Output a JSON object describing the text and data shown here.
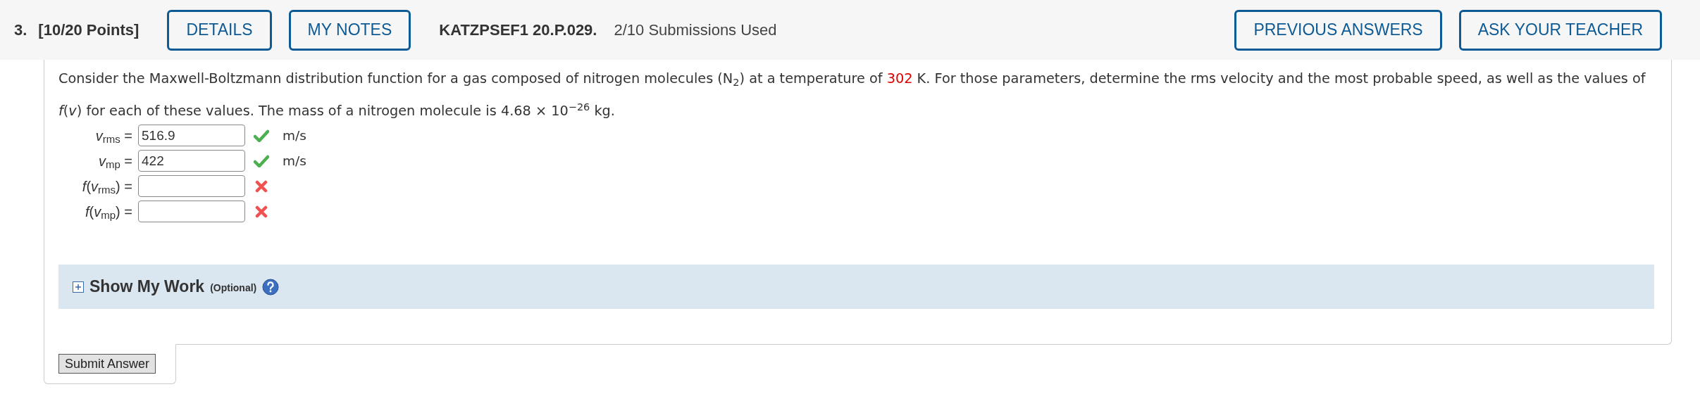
{
  "header": {
    "number": "3.",
    "points": "[10/20 Points]",
    "left_buttons": [
      "DETAILS",
      "MY NOTES"
    ],
    "code": "KATZPSEF1 20.P.029.",
    "submissions": "2/10 Submissions Used",
    "right_buttons": [
      "PREVIOUS ANSWERS",
      "ASK YOUR TEACHER"
    ]
  },
  "question": [
    {
      "kind": "plain",
      "text": "Consider the Maxwell-Boltzmann distribution function for a gas composed of nitrogen molecules (N$_{2}$) at a temperature of "
    },
    {
      "kind": "given",
      "text": "302"
    },
    {
      "kind": "plain",
      "text": " K. For those parameters, determine the rms velocity and the most probable speed, as well as the values of *f*(*v*) for each of these values. The mass of a nitrogen molecule is 4.68 × 10$^{−26}$ kg."
    }
  ],
  "answers": [
    {
      "label": "*v*$_{rms}$ =",
      "value": "516.9",
      "correct": true,
      "unit": "m/s"
    },
    {
      "label": "*v*$_{mp}$ =",
      "value": "422",
      "correct": true,
      "unit": "m/s"
    },
    {
      "label": "*f*(*v*$_{rms}$) =",
      "correct": false
    },
    {
      "label": "*f*(*v*$_{mp}$) =",
      "correct": false
    }
  ],
  "work": {
    "title": "Show My Work",
    "note": "(Optional)"
  },
  "submit": "Submit Answer"
}
